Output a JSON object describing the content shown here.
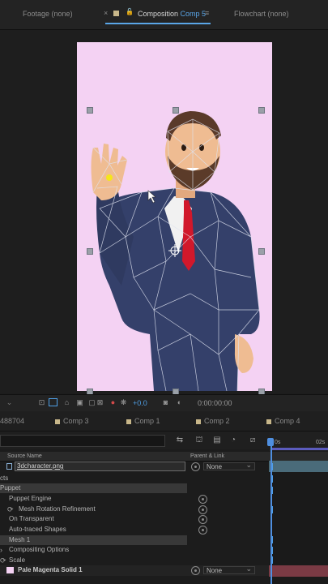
{
  "panel_tabs": {
    "footage": "Footage",
    "footage_value": "(none)",
    "composition": "Composition",
    "composition_name": "Comp 5",
    "menu_icon": "≡",
    "close_icon": "×",
    "lock_icon": "lock-icon",
    "flowchart": "Flowchart",
    "flowchart_value": "(none)"
  },
  "viewer": {
    "bg": "#1e1e1e",
    "canvas_color": "#f4d2f3",
    "exposure": "+0.0",
    "timecode": "0:00:00:00"
  },
  "timeline_tabs": {
    "partial": "488704",
    "tabs": [
      "Comp 3",
      "Comp 1",
      "Comp 2",
      "Comp 4"
    ]
  },
  "ruler": {
    "start": "0s",
    "end": "02s"
  },
  "headers": {
    "source_name": "Source Name",
    "parent_link": "Parent & Link"
  },
  "layers": {
    "layer1_name": "3dcharacter.png",
    "layer1_parent": "None",
    "effects_label": "cts",
    "puppet": "Puppet",
    "puppet_engine": "Puppet Engine",
    "mesh_rotation": "Mesh Rotation Refinement",
    "on_transparent": "On Transparent",
    "auto_traced": "Auto-traced Shapes",
    "mesh1": "Mesh 1",
    "compositing": "Compositing Options",
    "scale": "Scale",
    "layer2_name": "Pale Magenta Solid 1",
    "layer2_parent": "None",
    "layer2_color": "#f4d2f3"
  }
}
